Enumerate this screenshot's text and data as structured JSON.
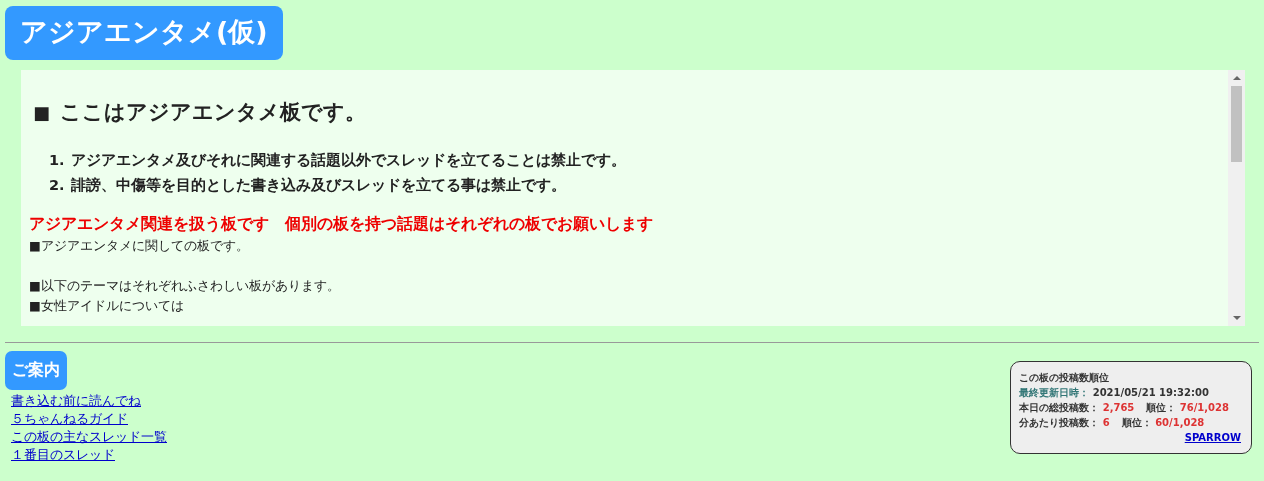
{
  "board_title": "アジアエンタメ(仮)",
  "notice": {
    "heading_mark": "■",
    "heading": "ここはアジアエンタメ板です。",
    "rules": [
      {
        "number": "1.",
        "text": "アジアエンタメ及びそれに関連する話題以外でスレッドを立てることは禁止です。"
      },
      {
        "number": "2.",
        "text": "誹謗、中傷等を目的とした書き込み及びスレッドを立てる事は禁止です。"
      }
    ],
    "red_line": "アジアエンタメ関連を扱う板です　個別の板を持つ話題はそれぞれの板でお願いします",
    "paragraphs": [
      [
        "■アジアエンタメに関しての板です。"
      ],
      [
        "■以下のテーマはそれぞれふさわしい板があります。",
        "■女性アイドルについては"
      ]
    ]
  },
  "guide": {
    "title": "ご案内",
    "links": [
      "書き込む前に読んでね",
      "５ちゃんねるガイド",
      "この板の主なスレッド一覧",
      "１番目のスレッド"
    ]
  },
  "ranking": {
    "title": "この板の投稿数順位",
    "rows": [
      [
        {
          "label": "最終更新日時：",
          "value": "2021/05/21 19:32:00",
          "kind": "date"
        }
      ],
      [
        {
          "label": "本日の総投稿数：",
          "value": "2,765",
          "kind": "number"
        },
        {
          "label": "順位：",
          "value": "76/1,028",
          "kind": "number"
        }
      ],
      [
        {
          "label": "分あたり投稿数：",
          "value": "6",
          "kind": "number"
        },
        {
          "label": "順位：",
          "value": "60/1,028",
          "kind": "number"
        }
      ]
    ],
    "link": "SPARROW"
  }
}
